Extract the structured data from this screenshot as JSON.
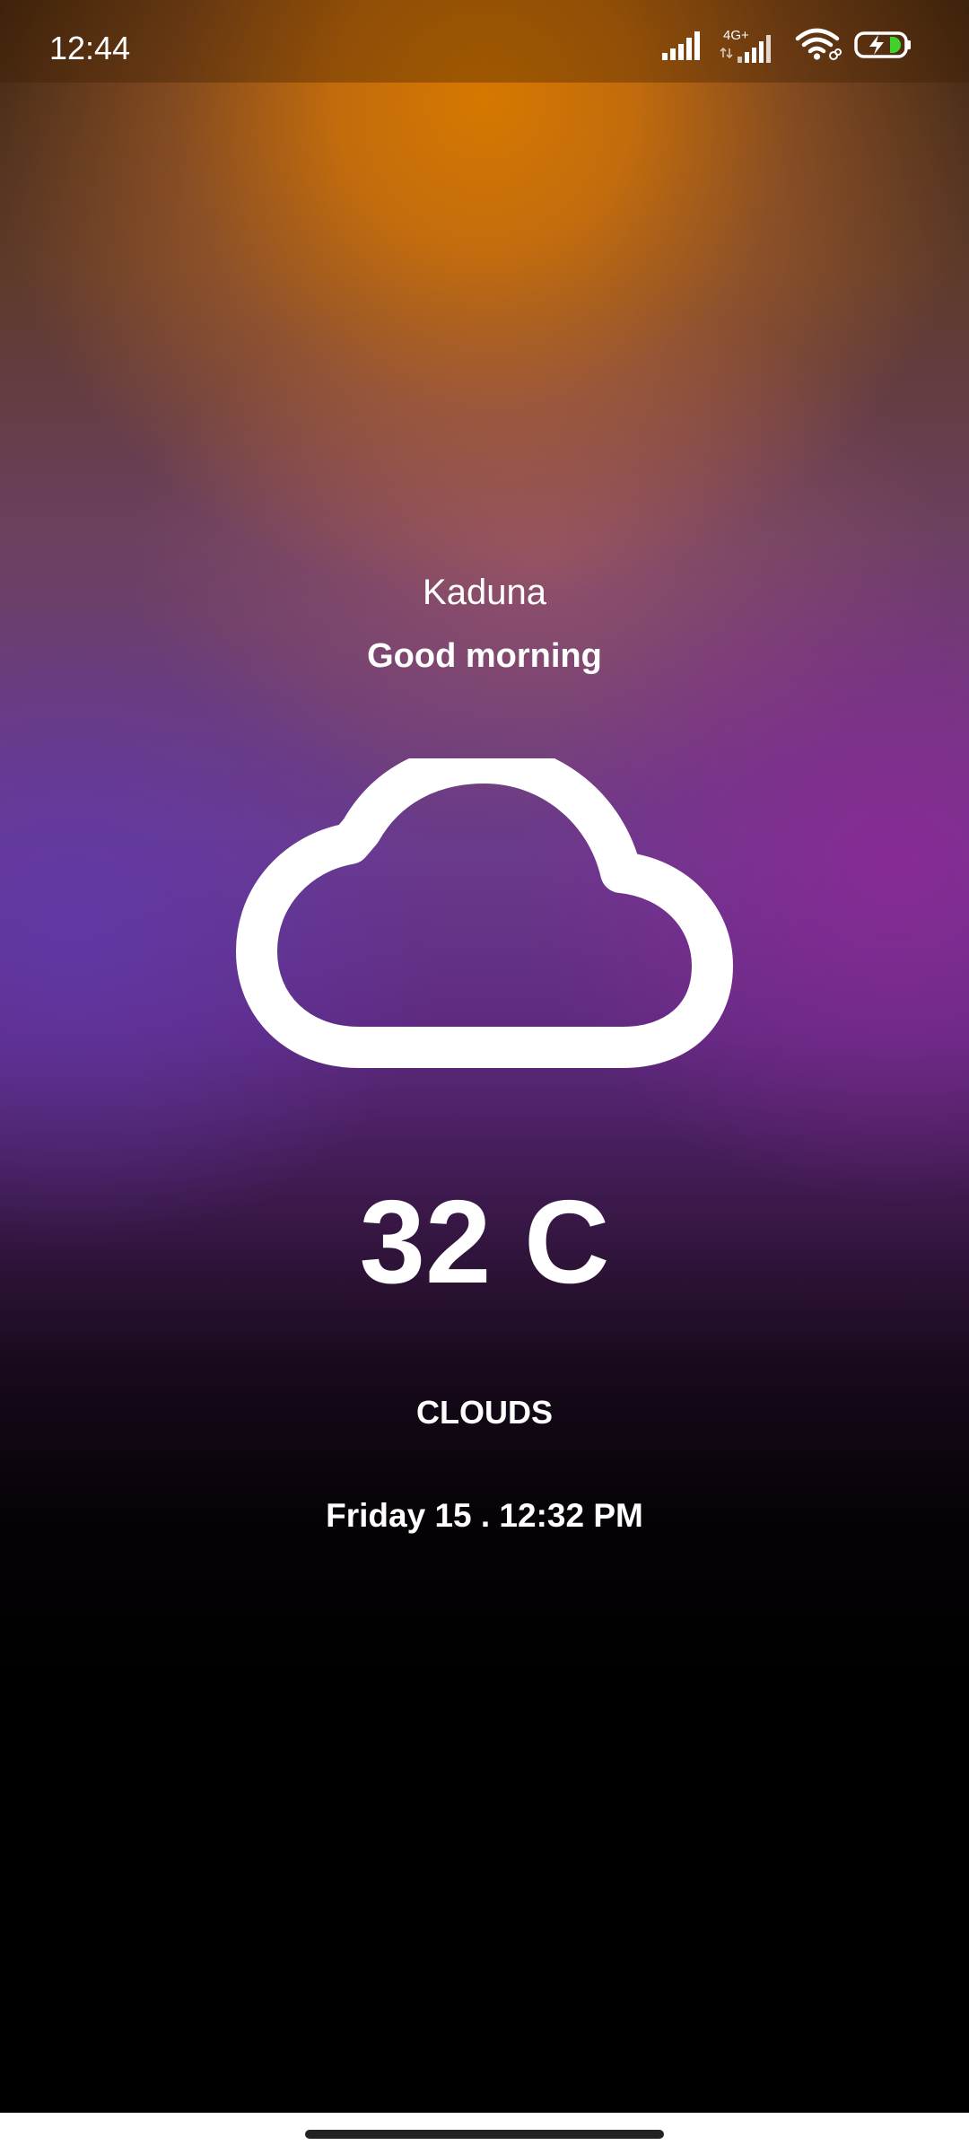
{
  "status_bar": {
    "time": "12:44",
    "network_label": "4G+",
    "icons": [
      "signal-icon",
      "signal-4g-icon",
      "wifi-icon",
      "battery-charging-icon"
    ],
    "battery_color": "#3fd22a"
  },
  "weather": {
    "location": "Kaduna",
    "greeting": "Good morning",
    "icon": "cloud-icon",
    "temperature": "32 C",
    "condition": "CLOUDS",
    "datetime": "Friday 15 . 12:32 PM"
  },
  "colors": {
    "accent_orange": "#d67800",
    "accent_purple": "#6a3a8c",
    "text": "#ffffff",
    "background_bottom": "#000000"
  }
}
